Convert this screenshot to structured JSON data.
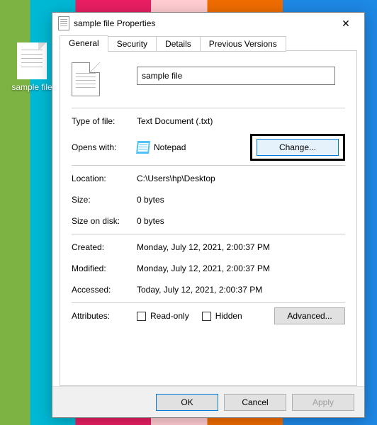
{
  "desktop": {
    "icon_label": "sample file"
  },
  "window": {
    "title": "sample file Properties"
  },
  "tabs": [
    {
      "label": "General",
      "active": true
    },
    {
      "label": "Security",
      "active": false
    },
    {
      "label": "Details",
      "active": false
    },
    {
      "label": "Previous Versions",
      "active": false
    }
  ],
  "filename": "sample file",
  "labels": {
    "type_of_file": "Type of file:",
    "opens_with": "Opens with:",
    "location": "Location:",
    "size": "Size:",
    "size_on_disk": "Size on disk:",
    "created": "Created:",
    "modified": "Modified:",
    "accessed": "Accessed:",
    "attributes": "Attributes:",
    "read_only": "Read-only",
    "hidden": "Hidden"
  },
  "values": {
    "type_of_file": "Text Document (.txt)",
    "opens_with": "Notepad",
    "location": "C:\\Users\\hp\\Desktop",
    "size": "0 bytes",
    "size_on_disk": "0 bytes",
    "created": "Monday, July 12, 2021, 2:00:37 PM",
    "modified": "Monday, July 12, 2021, 2:00:37 PM",
    "accessed": "Today, July 12, 2021, 2:00:37 PM"
  },
  "buttons": {
    "change": "Change...",
    "advanced": "Advanced...",
    "ok": "OK",
    "cancel": "Cancel",
    "apply": "Apply"
  }
}
